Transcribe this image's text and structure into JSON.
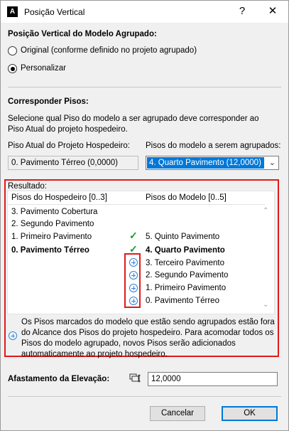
{
  "window": {
    "title": "Posição Vertical",
    "help_label": "?",
    "close_label": "✕"
  },
  "vertical_position": {
    "heading": "Posição Vertical do Modelo Agrupado:",
    "option_original": "Original (conforme definido no projeto agrupado)",
    "option_custom": "Personalizar",
    "selected": "custom"
  },
  "match_stories": {
    "heading": "Corresponder Pisos:",
    "description_line1": "Selecione qual Piso do modelo a ser agrupado deve corresponder ao",
    "description_line2": "Piso Atual do projeto hospedeiro.",
    "host_label": "Piso Atual do Projeto Hospedeiro:",
    "host_value": "0. Pavimento Térreo (0,0000)",
    "model_label": "Pisos do modelo a serem agrupados:",
    "model_value": "4. Quarto Pavimento (12,0000)"
  },
  "result": {
    "label": "Resultado:",
    "host_header": "Pisos do Hospedeiro [0..3]",
    "model_header": "Pisos do Modelo [0..5]",
    "host_stories": [
      "3. Pavimento Cobertura",
      "2. Segundo Pavimento",
      "1. Primeiro Pavimento",
      "0. Pavimento Térreo"
    ],
    "model_stories": [
      "5. Quinto Pavimento",
      "4. Quarto Pavimento",
      "3. Terceiro Pavimento",
      "2. Segundo Pavimento",
      "1. Primeiro Pavimento",
      "0. Pavimento Térreo"
    ],
    "note": "Os Pisos marcados do modelo que estão sendo agrupados estão fora do Alcance dos Pisos do projeto hospedeiro. Para acomodar todos os Pisos do modelo agrupado, novos Pisos serão adicionados automaticamente ao projeto hospedeiro."
  },
  "elevation": {
    "label": "Afastamento da Elevação:",
    "value": "12,0000"
  },
  "buttons": {
    "cancel": "Cancelar",
    "ok": "OK"
  },
  "colors": {
    "highlight": "#e01a1a",
    "selection": "#0078d7",
    "check": "#1a9a2a",
    "plus": "#2f7fd6"
  }
}
